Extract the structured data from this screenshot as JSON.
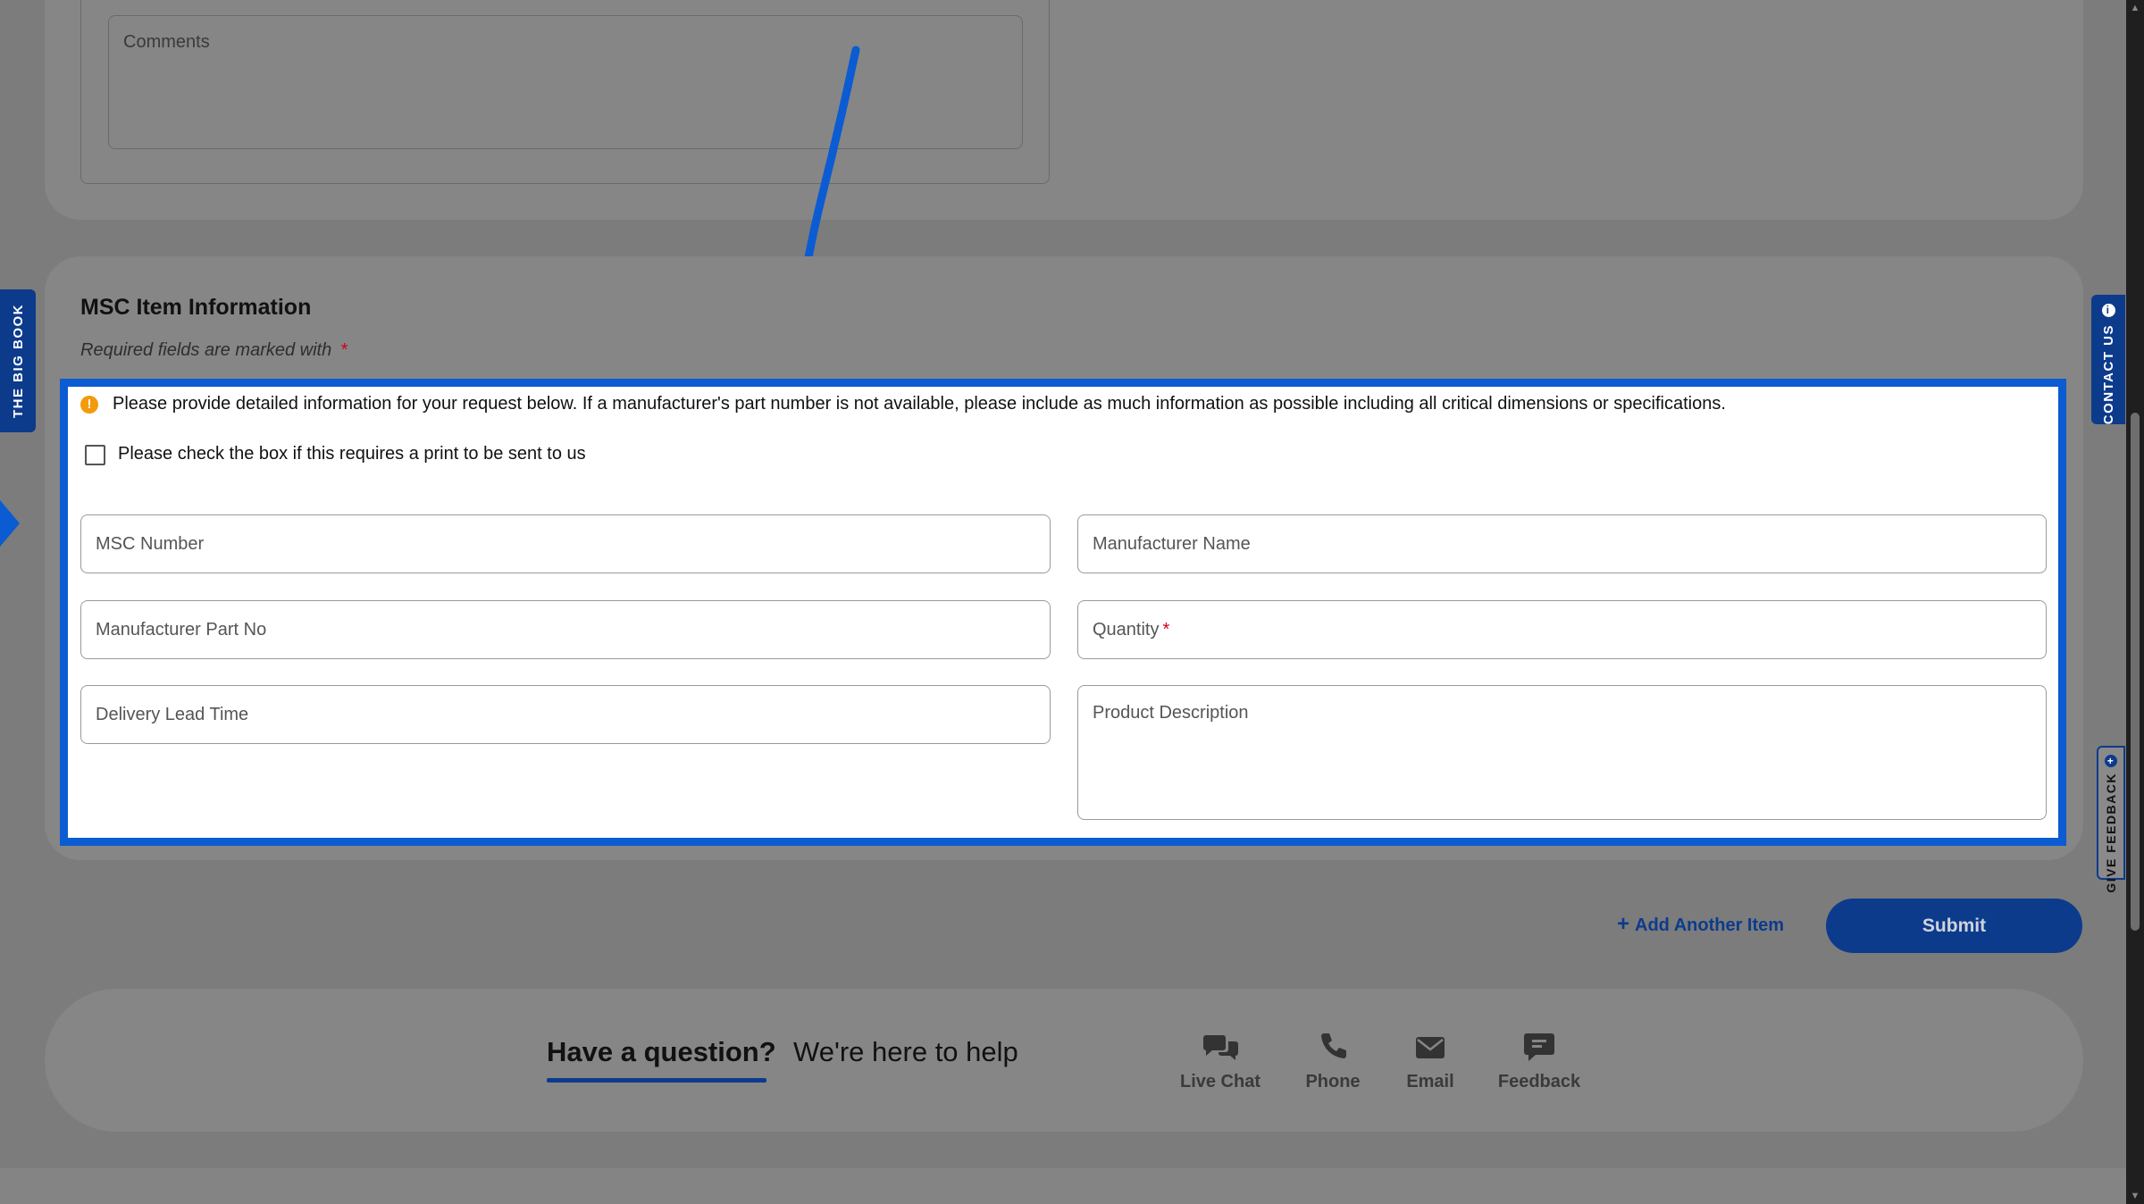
{
  "form": {
    "comments_placeholder": "Comments",
    "section_title": "MSC Item Information",
    "required_note": "Required fields are marked with",
    "required_mark": "*",
    "info_message": "Please provide detailed information for your request below. If a manufacturer's part number is not available, please include as much information as possible including all critical dimensions or specifications.",
    "print_checkbox_label": "Please check the box if this requires a print to be sent to us",
    "print_checkbox_checked": false,
    "fields": {
      "msc_number": "MSC Number",
      "manufacturer_name": "Manufacturer Name",
      "manufacturer_part_no": "Manufacturer Part No",
      "quantity": "Quantity",
      "delivery_lead_time": "Delivery Lead Time",
      "product_description": "Product Description"
    },
    "add_item_label": "Add Another Item",
    "submit_label": "Submit"
  },
  "help": {
    "title": "Have a question?",
    "subtitle": "We're here to help",
    "options": [
      {
        "label": "Live Chat",
        "icon": "chat-bubbles-icon"
      },
      {
        "label": "Phone",
        "icon": "phone-icon"
      },
      {
        "label": "Email",
        "icon": "envelope-icon"
      },
      {
        "label": "Feedback",
        "icon": "feedback-icon"
      }
    ]
  },
  "side_tabs": {
    "big_book": "THE BIG BOOK",
    "contact_us": "CONTACT US",
    "give_feedback": "GIVE FEEDBACK"
  },
  "colors": {
    "highlight_border": "#0b5bd3",
    "brand_blue": "#0d3b8c",
    "warning": "#f29b0b",
    "overlay": "#7c7c7c"
  }
}
